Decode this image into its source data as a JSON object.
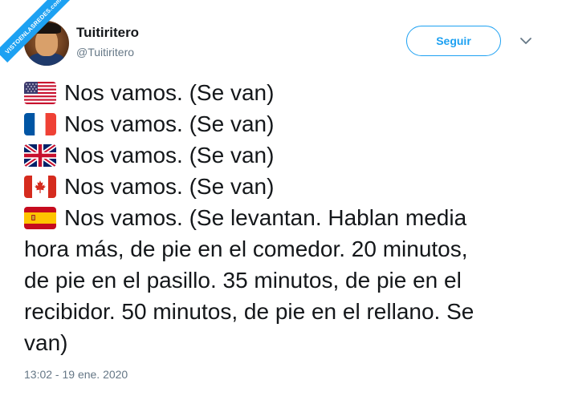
{
  "watermark": "VISTOENLASREDES.com",
  "author": {
    "name": "Tuitiritero",
    "handle": "@Tuitiritero"
  },
  "follow_button": "Seguir",
  "tweet": {
    "lines": [
      {
        "flag": "us-flag-icon",
        "text": "Nos vamos. (Se van)"
      },
      {
        "flag": "france-flag-icon",
        "text": "Nos vamos. (Se van)"
      },
      {
        "flag": "uk-flag-icon",
        "text": "Nos vamos. (Se van)"
      },
      {
        "flag": "canada-flag-icon",
        "text": "Nos vamos. (Se van)"
      }
    ],
    "spain": {
      "flag": "spain-flag-icon",
      "line1": "Nos vamos. (Se levantan. Hablan media",
      "line2": "hora más, de pie en el comedor. 20 minutos,",
      "line3": "de pie en el pasillo. 35 minutos, de pie en el",
      "line4": "recibidor. 50 minutos, de pie en el rellano. Se",
      "line5": "van)"
    }
  },
  "timestamp": "13:02 - 19 ene. 2020",
  "colors": {
    "accent": "#1da1f2",
    "text": "#14171a",
    "secondary_text": "#657786"
  }
}
